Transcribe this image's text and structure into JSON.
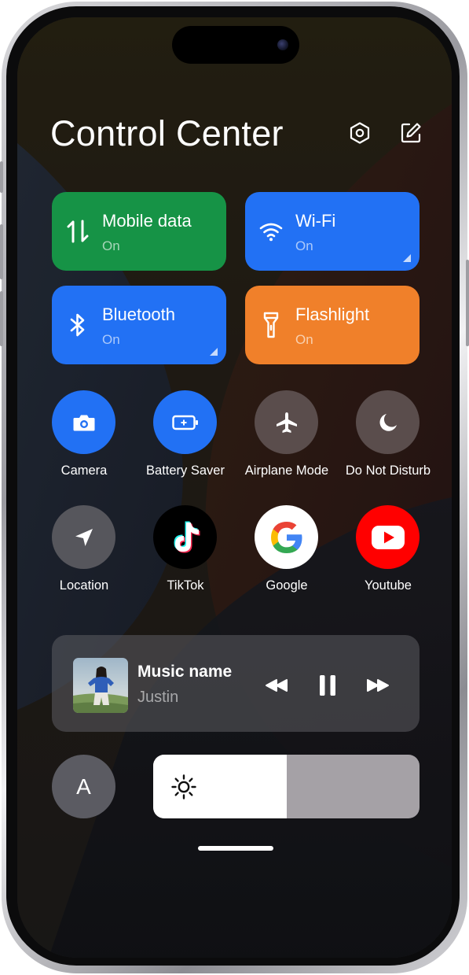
{
  "header": {
    "title": "Control Center",
    "settings_icon": "hexagon-settings-icon",
    "edit_icon": "edit-icon"
  },
  "tiles": [
    {
      "label": "Mobile data",
      "status": "On",
      "icon": "mobile-data-icon",
      "color": "#169346"
    },
    {
      "label": "Wi-Fi",
      "status": "On",
      "icon": "wifi-icon",
      "color": "#2271f4"
    },
    {
      "label": "Bluetooth",
      "status": "On",
      "icon": "bluetooth-icon",
      "color": "#2271f4"
    },
    {
      "label": "Flashlight",
      "status": "On",
      "icon": "flashlight-icon",
      "color": "#f0802a"
    }
  ],
  "toggles": [
    {
      "label": "Camera",
      "icon": "camera-icon",
      "color": "#2271f4"
    },
    {
      "label": "Battery Saver",
      "icon": "battery-icon",
      "color": "#2271f4"
    },
    {
      "label": "Airplane Mode",
      "icon": "airplane-icon",
      "color": "#5a4d4c"
    },
    {
      "label": "Do Not Disturb",
      "icon": "moon-icon",
      "color": "#5a4d4c"
    }
  ],
  "apps": [
    {
      "label": "Location",
      "icon": "location-arrow-icon",
      "color": "#56565c"
    },
    {
      "label": "TikTok",
      "icon": "tiktok-icon",
      "color": "#000000"
    },
    {
      "label": "Google",
      "icon": "google-icon",
      "color": "#ffffff"
    },
    {
      "label": "Youtube",
      "icon": "youtube-icon",
      "color": "#ff0000"
    }
  ],
  "music": {
    "title": "Music name",
    "artist": "Justin",
    "controls": [
      "rewind-icon",
      "pause-icon",
      "fast-forward-icon"
    ]
  },
  "display": {
    "auto_label": "A",
    "brightness_icon": "sun-icon",
    "brightness_fraction": 0.5
  }
}
